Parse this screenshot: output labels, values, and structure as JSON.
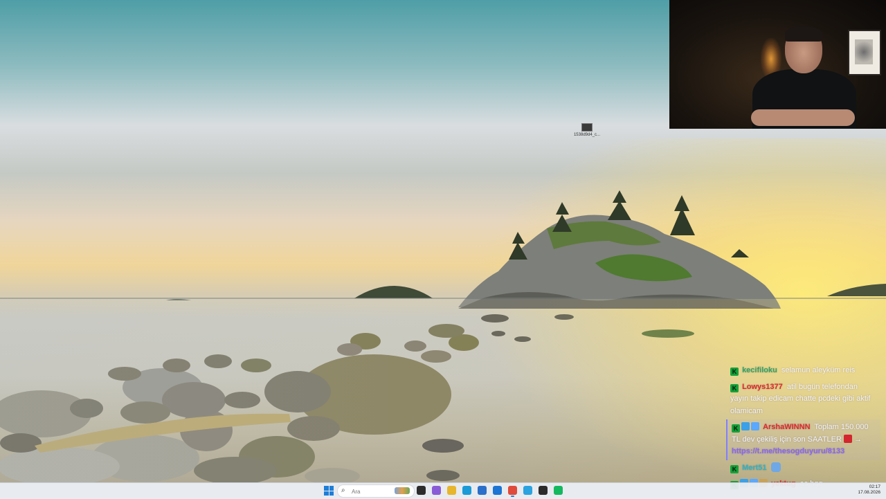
{
  "desktop": {
    "icons": [
      {
        "label": "1538d9d4_c..."
      }
    ]
  },
  "chat": {
    "messages": [
      {
        "badges": [
          "K"
        ],
        "user": "kecifiloku",
        "user_color": "#2fa36a",
        "text": "selamun aleyküm reis",
        "highlight": false
      },
      {
        "badges": [
          "K"
        ],
        "user": "Lowys1377",
        "user_color": "#e2262f",
        "text": "atil bugün telefondan yayın takip edicam chatte pcdeki gibi aktif olamicam",
        "highlight": false
      },
      {
        "badges": [
          "K",
          "b2",
          "b3"
        ],
        "user": "ArshaWINNN",
        "user_color": "#e2262f",
        "text": "Toplam 150.000 TL dev çekiliş için son SAATLER",
        "text_after": "→",
        "link": "https://t.me/thesogduyuru/8133",
        "highlight": true
      },
      {
        "badges": [
          "K"
        ],
        "user": "Mert51",
        "user_color": "#2fb3c8",
        "text": "",
        "highlight": false
      },
      {
        "badges": [
          "K",
          "b2",
          "b3",
          "b4"
        ],
        "user": "yektug",
        "user_color": "#e2262f",
        "text": "as hgg",
        "highlight": false
      }
    ]
  },
  "taskbar": {
    "search_placeholder": "Ara",
    "apps": [
      {
        "name": "task-view-icon",
        "color": "#2c2c2c"
      },
      {
        "name": "colorful-app-icon",
        "color": "#8a5bd6"
      },
      {
        "name": "file-explorer-icon",
        "color": "#e8b62c"
      },
      {
        "name": "edge-icon",
        "color": "#1a9bd7"
      },
      {
        "name": "photos-icon",
        "color": "#2a6fc9"
      },
      {
        "name": "mail-icon",
        "color": "#1c74d4"
      },
      {
        "name": "chrome-icon",
        "color": "#e04a3a"
      },
      {
        "name": "telegram-icon",
        "color": "#2aa3e0"
      },
      {
        "name": "media-app-icon",
        "color": "#2b2b2b"
      },
      {
        "name": "green-app-icon",
        "color": "#14b85f"
      }
    ],
    "time": "02:17",
    "date": "17.08.2026"
  }
}
